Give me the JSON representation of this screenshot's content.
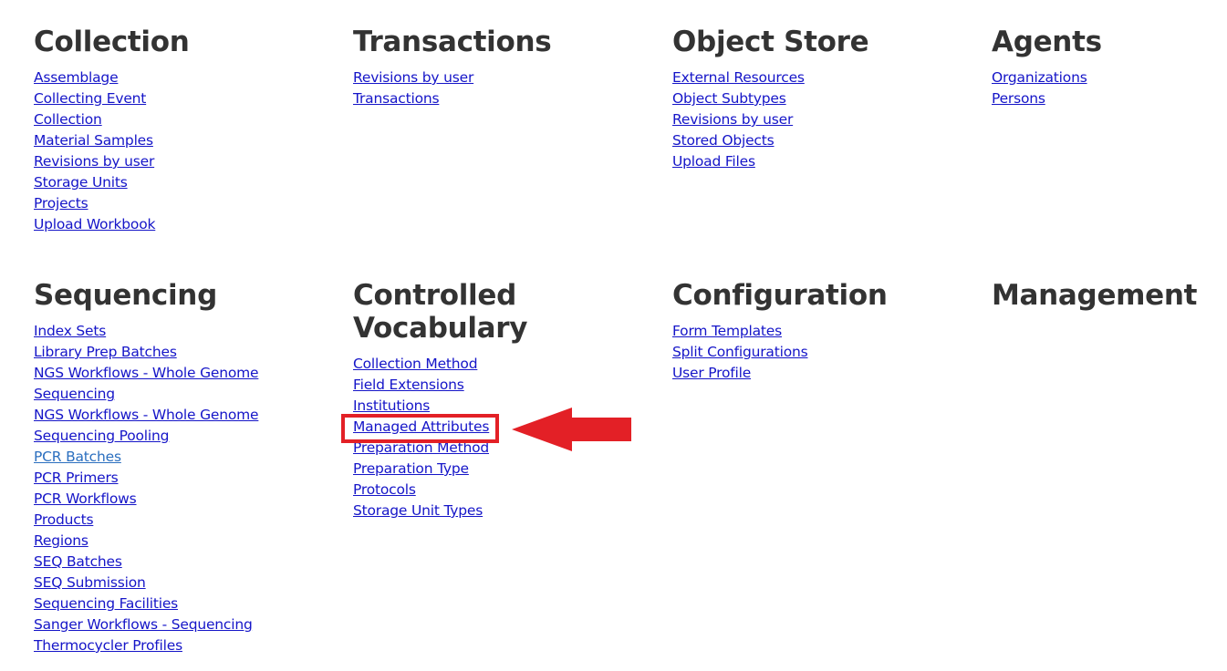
{
  "sections": [
    {
      "title": "Collection",
      "links": [
        "Assemblage",
        "Collecting Event",
        "Collection",
        "Material Samples",
        "Revisions by user",
        "Storage Units",
        "Projects",
        "Upload Workbook"
      ]
    },
    {
      "title": "Transactions",
      "links": [
        "Revisions by user",
        "Transactions"
      ]
    },
    {
      "title": "Object Store",
      "links": [
        "External Resources",
        "Object Subtypes",
        "Revisions by user",
        "Stored Objects",
        "Upload Files"
      ]
    },
    {
      "title": "Agents",
      "links": [
        "Organizations",
        "Persons"
      ]
    },
    {
      "title": "Sequencing",
      "links": [
        "Index Sets",
        "Library Prep Batches",
        "NGS Workflows - Whole Genome",
        "Sequencing",
        "NGS Workflows - Whole Genome",
        "Sequencing Pooling",
        "PCR Batches",
        "PCR Primers",
        "PCR Workflows",
        "Products",
        "Regions",
        "SEQ Batches",
        "SEQ Submission",
        "Sequencing Facilities",
        "Sanger Workflows - Sequencing",
        "Thermocycler Profiles"
      ]
    },
    {
      "title_line1": "Controlled",
      "title_line2": "Vocabulary",
      "links": [
        "Collection Method",
        "Field Extensions",
        "Institutions",
        "Managed Attributes",
        "Preparation Method",
        "Preparation Type",
        "Protocols",
        "Storage Unit Types"
      ]
    },
    {
      "title": "Configuration",
      "links": [
        "Form Templates",
        "Split Configurations",
        "User Profile"
      ]
    },
    {
      "title": "Management",
      "links": []
    }
  ],
  "annotation": {
    "highlighted_link": "Managed Attributes",
    "color": "#e32026"
  },
  "colors": {
    "heading": "#333333",
    "link": "#1515c8",
    "hovered_link": "#2b6fbf"
  }
}
